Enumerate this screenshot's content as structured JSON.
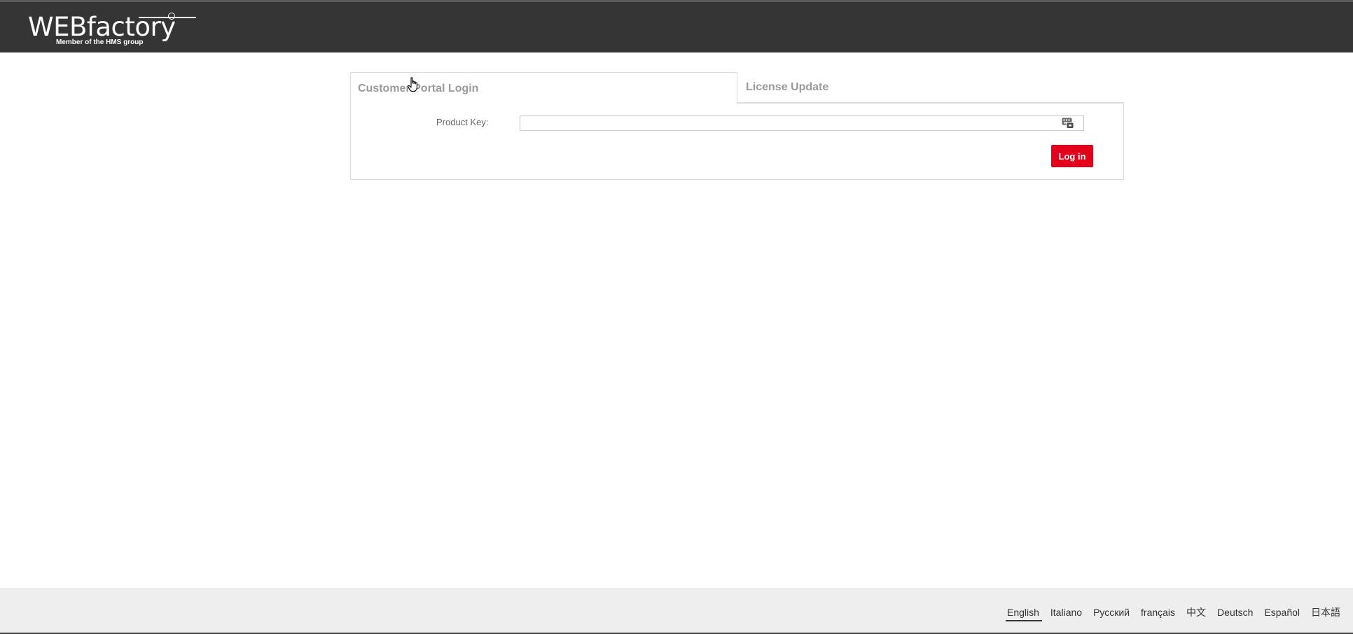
{
  "header": {
    "logo_text": "WEBfactory",
    "logo_subtext": "Member of the HMS group",
    "background_color": "#353535"
  },
  "tabs": [
    {
      "label": "Customer Portal Login",
      "active": true
    },
    {
      "label": "License Update",
      "active": false
    }
  ],
  "form": {
    "product_key_label": "Product Key:",
    "product_key_value": "",
    "product_key_placeholder": "",
    "input_icon": "keyboard-icon",
    "login_label": "Log in",
    "login_color": "#e3001b"
  },
  "footer": {
    "languages": [
      {
        "label": "English",
        "active": true
      },
      {
        "label": "Italiano",
        "active": false
      },
      {
        "label": "Русский",
        "active": false
      },
      {
        "label": "français",
        "active": false
      },
      {
        "label": "中文",
        "active": false
      },
      {
        "label": "Deutsch",
        "active": false
      },
      {
        "label": "Español",
        "active": false
      },
      {
        "label": "日本語",
        "active": false
      }
    ]
  }
}
